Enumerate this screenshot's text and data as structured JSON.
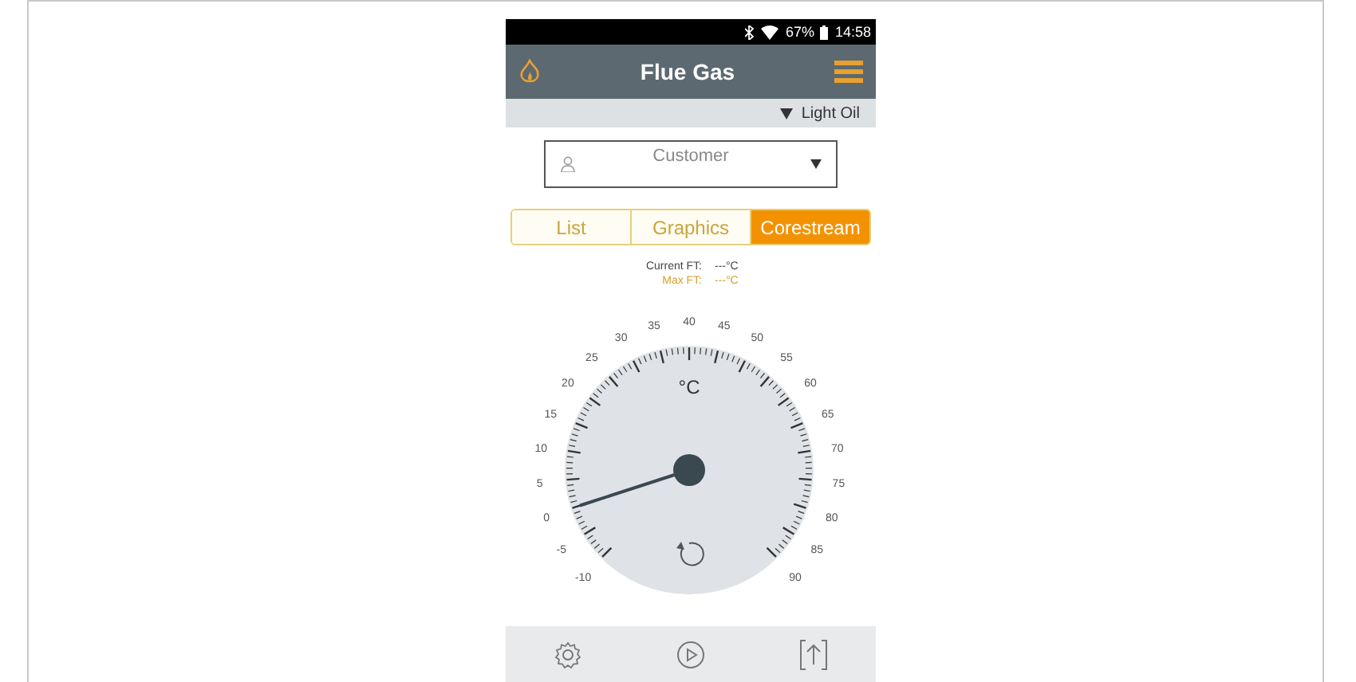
{
  "status_bar": {
    "battery": "67%",
    "time": "14:58"
  },
  "header": {
    "title": "Flue Gas"
  },
  "fuel": {
    "label": "Light Oil"
  },
  "customer": {
    "placeholder": "Customer"
  },
  "tabs": [
    {
      "label": "List",
      "selected": false
    },
    {
      "label": "Graphics",
      "selected": false
    },
    {
      "label": "Corestream",
      "selected": true
    }
  ],
  "readings": [
    {
      "kind": "current",
      "label": "Current FT:",
      "value": "---°C"
    },
    {
      "kind": "max",
      "label": "Max FT:",
      "value": "---°C"
    }
  ],
  "gauge": {
    "unit": "°C",
    "scale": [
      "-10",
      "-5",
      "0",
      "5",
      "10",
      "15",
      "20",
      "25",
      "30",
      "35",
      "40",
      "45",
      "50",
      "55",
      "60",
      "65",
      "70",
      "75",
      "80",
      "85",
      "90"
    ]
  }
}
